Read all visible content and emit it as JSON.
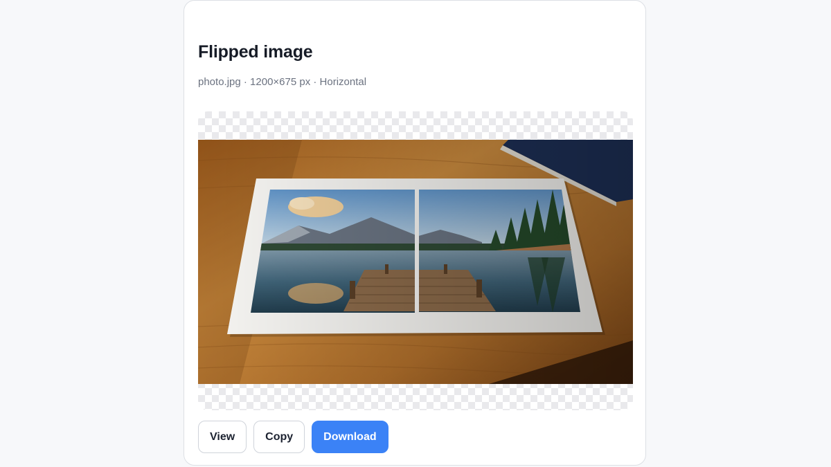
{
  "card": {
    "title": "Flipped image",
    "subtitle": "photo.jpg · 1200×675 px · Horizontal"
  },
  "preview": {
    "image_description_icon": "flipped-photo-image"
  },
  "actions": {
    "view_label": "View",
    "copy_label": "Copy",
    "download_label": "Download"
  },
  "colors": {
    "accent": "#3b82f6",
    "text_primary": "#161b26",
    "text_secondary": "#6b7280",
    "page_bg": "#f7f8fa"
  }
}
